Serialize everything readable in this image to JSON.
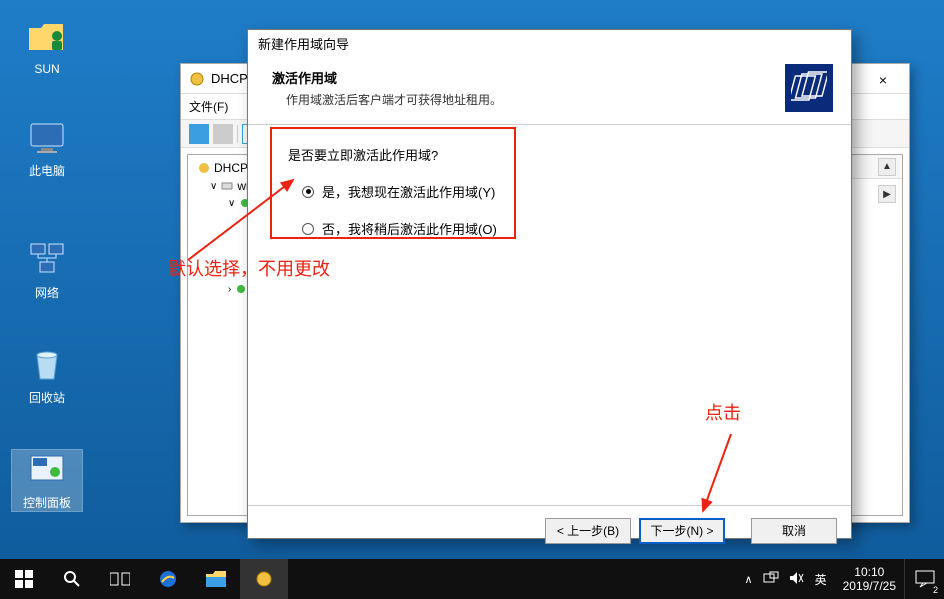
{
  "desktop": {
    "icons": [
      {
        "label": "SUN"
      },
      {
        "label": "此电脑"
      },
      {
        "label": "网络"
      },
      {
        "label": "回收站"
      },
      {
        "label": "控制面板"
      }
    ]
  },
  "dhcp_window": {
    "title": "DHCP",
    "menu_file": "文件(F)",
    "tree": {
      "root": "DHCP",
      "server": "wir",
      "back": "←",
      "fwd": "→"
    },
    "close": "×"
  },
  "wizard": {
    "title": "新建作用域向导",
    "heading": "激活作用域",
    "subheading": "作用域激活后客户端才可获得地址租用。",
    "question": "是否要立即激活此作用域?",
    "radio_yes": "是，我想现在激活此作用域(Y)",
    "radio_no": "否，我将稍后激活此作用域(O)",
    "back_btn": "< 上一步(B)",
    "next_btn": "下一步(N) >",
    "cancel_btn": "取消"
  },
  "annotations": {
    "default_note": "默认选择，不用更改",
    "click_note": "点击"
  },
  "taskbar": {
    "ime": "英",
    "time": "10:10",
    "date": "2019/7/25",
    "notif_count": "2"
  }
}
